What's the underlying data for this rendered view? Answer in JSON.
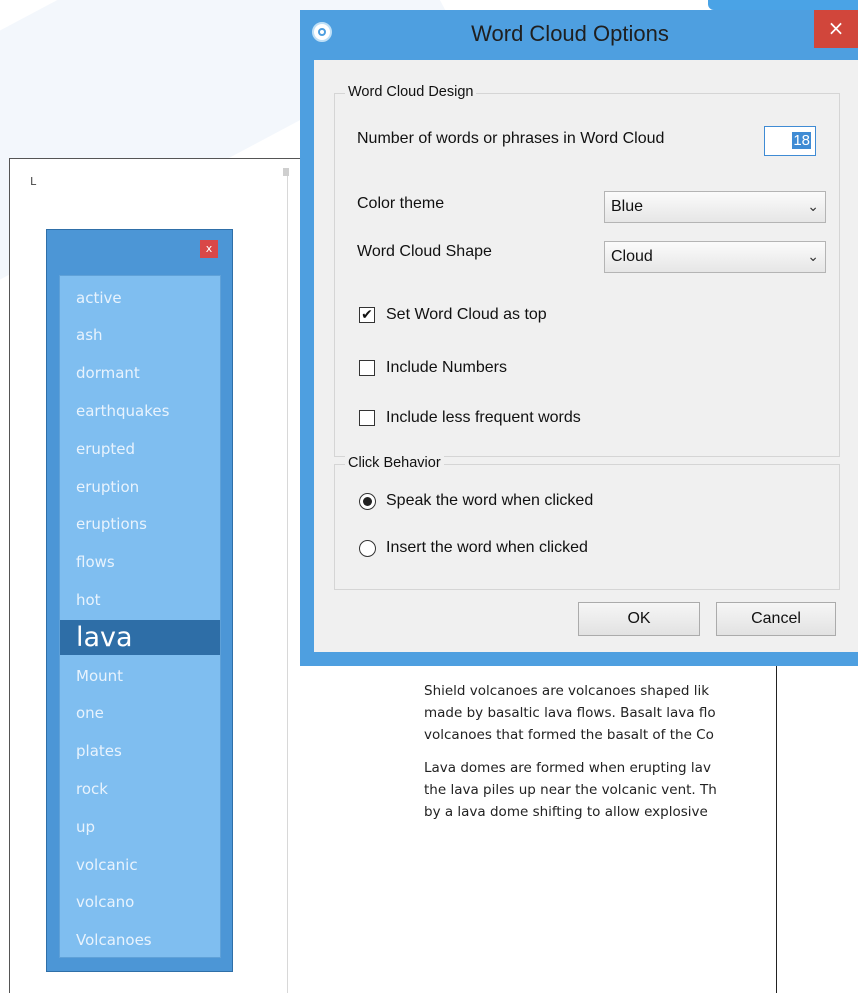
{
  "colors": {
    "dialog_frame": "#4e9fe0",
    "close_red": "#d1463b",
    "wordlist_bg": "#7fbef0",
    "wordlist_selected": "#2e6ea7"
  },
  "ruler": {
    "mark": "L"
  },
  "wordlist": {
    "close_label": "x",
    "selected_word": "lava",
    "words": [
      "active",
      "ash",
      "dormant",
      "earthquakes",
      "erupted",
      "eruption",
      "eruptions",
      "flows",
      "hot",
      "lava",
      "Mount",
      "one",
      "plates",
      "rock",
      "up",
      "volcanic",
      "volcano",
      "Volcanoes"
    ]
  },
  "document": {
    "paragraph1": [
      "Shield volcanoes are volcanoes shaped lik",
      "made by basaltic lava flows. Basalt lava flo",
      "volcanoes that formed the basalt of the Co"
    ],
    "paragraph2": [
      "Lava domes are formed when erupting lav",
      "the lava piles up near the volcanic vent. Th",
      "by a lava dome shifting to allow explosive"
    ]
  },
  "dialog": {
    "title": "Word Cloud Options",
    "close_label": "×",
    "icon": "app-logo-icon",
    "design_group": {
      "label": "Word Cloud Design",
      "num_words_label": "Number of words or phrases in Word Cloud",
      "num_words_value": "18",
      "color_theme_label": "Color theme",
      "color_theme_value": "Blue",
      "shape_label": "Word Cloud Shape",
      "shape_value": "Cloud",
      "set_top_label": "Set Word Cloud as top",
      "set_top_checked": true,
      "include_numbers_label": "Include Numbers",
      "include_numbers_checked": false,
      "include_less_frequent_label": "Include less frequent words",
      "include_less_frequent_checked": false
    },
    "click_group": {
      "label": "Click Behavior",
      "speak_label": "Speak the word when clicked",
      "speak_selected": true,
      "insert_label": "Insert the word when clicked",
      "insert_selected": false
    },
    "ok_label": "OK",
    "cancel_label": "Cancel"
  }
}
